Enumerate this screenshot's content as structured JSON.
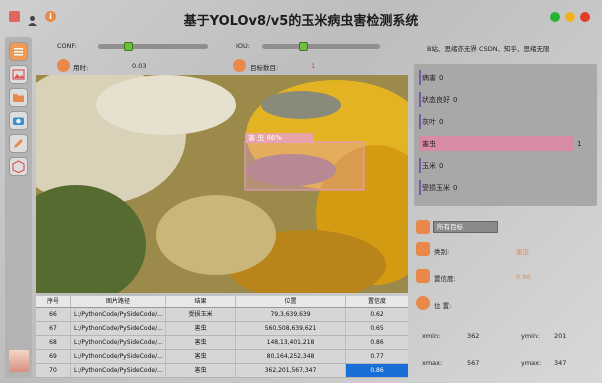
{
  "window": {
    "title": "基于YOLOv8/v5的玉米病虫害检测系统"
  },
  "controls": {
    "conf_label": "CONF:",
    "iou_label": "IOU:",
    "time_label": "用时:",
    "time_value": "0.03",
    "count_label": "目标数目:",
    "count_value": "1"
  },
  "credit": "B站、思绪亦无界  CSDN、知乎、思绪无限",
  "detection": {
    "box_label": "害 虫  86%"
  },
  "table": {
    "headers": [
      "序号",
      "图片路径",
      "结果",
      "位置",
      "置信度"
    ],
    "rows": [
      [
        "66",
        "L:/PythonCode/PySideCode/...",
        "受损玉米",
        "79,3,639,639",
        "0.62"
      ],
      [
        "67",
        "L:/PythonCode/PySideCode/...",
        "害虫",
        "560,508,639,621",
        "0.65"
      ],
      [
        "68",
        "L:/PythonCode/PySideCode/...",
        "害虫",
        "148,13,401,218",
        "0.86"
      ],
      [
        "69",
        "L:/PythonCode/PySideCode/...",
        "害虫",
        "80,164,252,348",
        "0.77"
      ],
      [
        "70",
        "L:/PythonCode/PySideCode/...",
        "害虫",
        "362,201,567,347",
        "0.86"
      ]
    ]
  },
  "chart_data": {
    "type": "bar",
    "categories": [
      "病害",
      "状态良好",
      "灰叶",
      "害虫",
      "玉米",
      "受损玉米"
    ],
    "values": [
      0,
      0,
      0,
      1,
      0,
      0
    ],
    "value_labels": [
      "0",
      "0",
      "0",
      "1",
      "0",
      "0"
    ],
    "highlight_color": "#d98aa4"
  },
  "result": {
    "select_value": "所有目标",
    "class_label": "类别:",
    "class_value": "害虫",
    "conf_label": "置信度:",
    "conf_value": "0.86",
    "pos_label": "位 置:",
    "xmin_label": "xmin:",
    "xmin_value": "362",
    "ymin_label": "ymin:",
    "ymin_value": "201",
    "xmax_label": "xmax:",
    "xmax_value": "567",
    "ymax_label": "ymax:",
    "ymax_value": "347"
  },
  "colors": {
    "accent_orange": "#e8894a",
    "conf_knob": "#6fbf3a",
    "selected_cell": "#1a6fd6"
  }
}
